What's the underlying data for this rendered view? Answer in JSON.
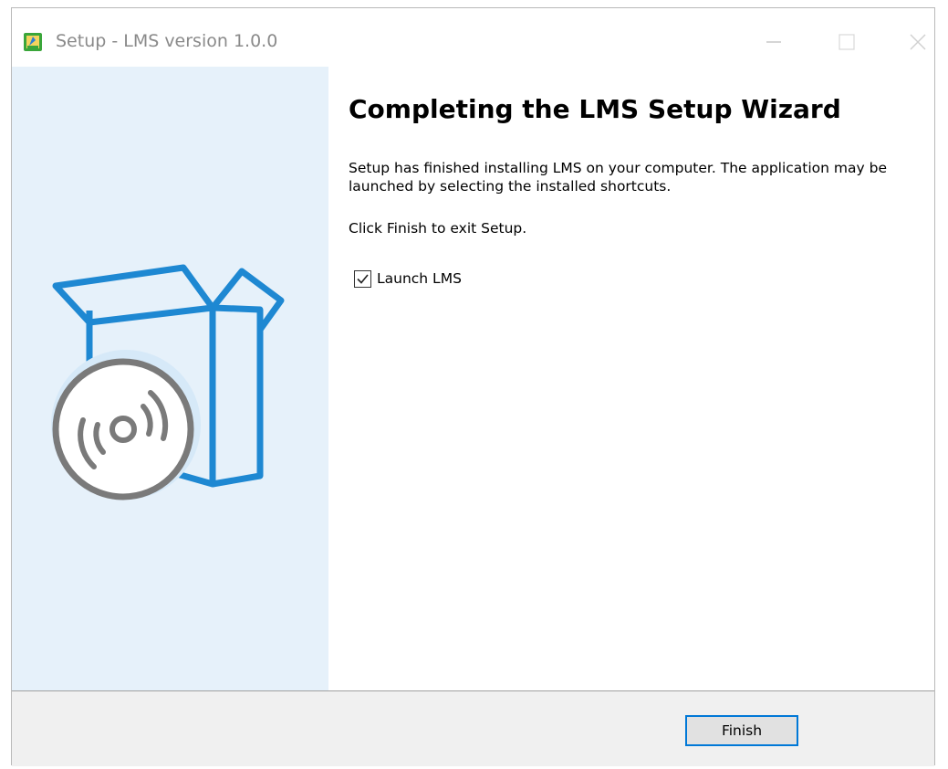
{
  "window": {
    "title": "Setup - LMS version 1.0.0",
    "icon": "installer-app-icon"
  },
  "caption_buttons": {
    "minimize_icon": "minimize-icon",
    "maximize_icon": "maximize-icon",
    "close_icon": "close-icon"
  },
  "sidebar": {
    "illustration": "software-box-with-disc-illustration",
    "background_color": "#e6f1fa",
    "accent_color": "#1e88d2",
    "disc_color": "#7a7a7a"
  },
  "main": {
    "heading": "Completing the LMS Setup Wizard",
    "description": "Setup has finished installing LMS on your computer. The application may be launched by selecting the installed shortcuts.",
    "instruction": "Click Finish to exit Setup.",
    "launch_checkbox": {
      "label": "Launch LMS",
      "checked": true
    }
  },
  "footer": {
    "finish_label": "Finish"
  }
}
